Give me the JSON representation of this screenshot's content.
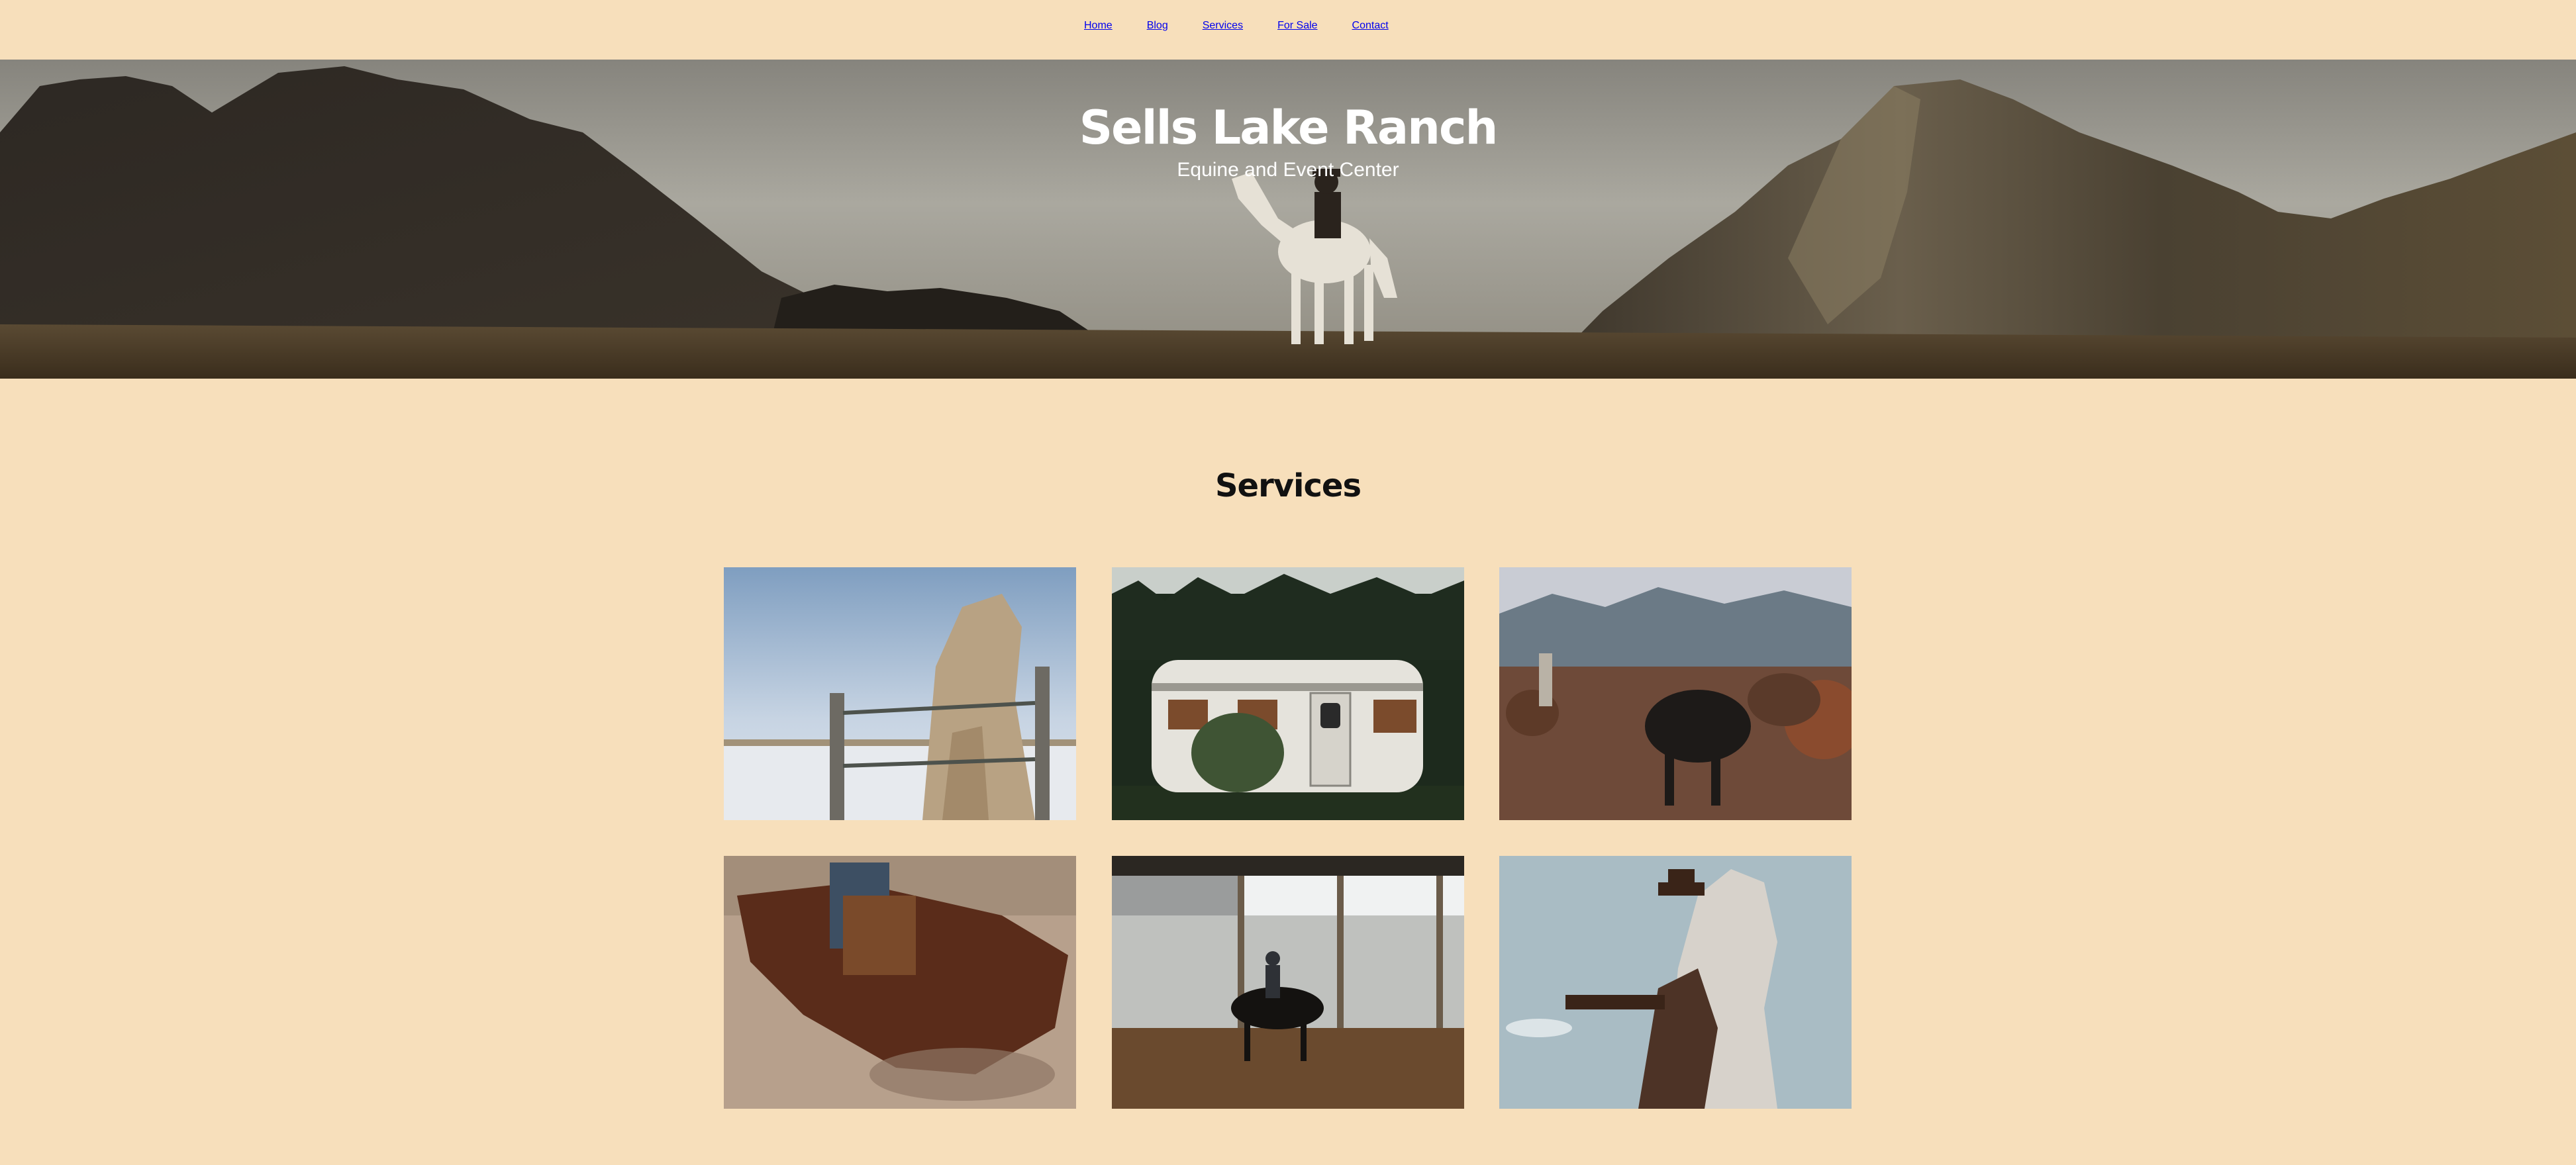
{
  "nav": {
    "items": [
      {
        "label": "Home"
      },
      {
        "label": "Blog"
      },
      {
        "label": "Services"
      },
      {
        "label": "For Sale"
      },
      {
        "label": "Contact"
      }
    ]
  },
  "hero": {
    "title": "Sells Lake Ranch",
    "subtitle": "Equine and Event Center"
  },
  "services": {
    "heading": "Services",
    "tiles": [
      {
        "name": "horse-at-fence-photo"
      },
      {
        "name": "camper-trailer-photo"
      },
      {
        "name": "cattle-herd-photo"
      },
      {
        "name": "barrel-racing-horse-photo"
      },
      {
        "name": "indoor-arena-rider-photo"
      },
      {
        "name": "cowboy-on-white-horse-photo"
      }
    ]
  },
  "colors": {
    "background": "#f7dfbb",
    "text": "#1c1c1c",
    "hero_text": "#ffffff"
  }
}
